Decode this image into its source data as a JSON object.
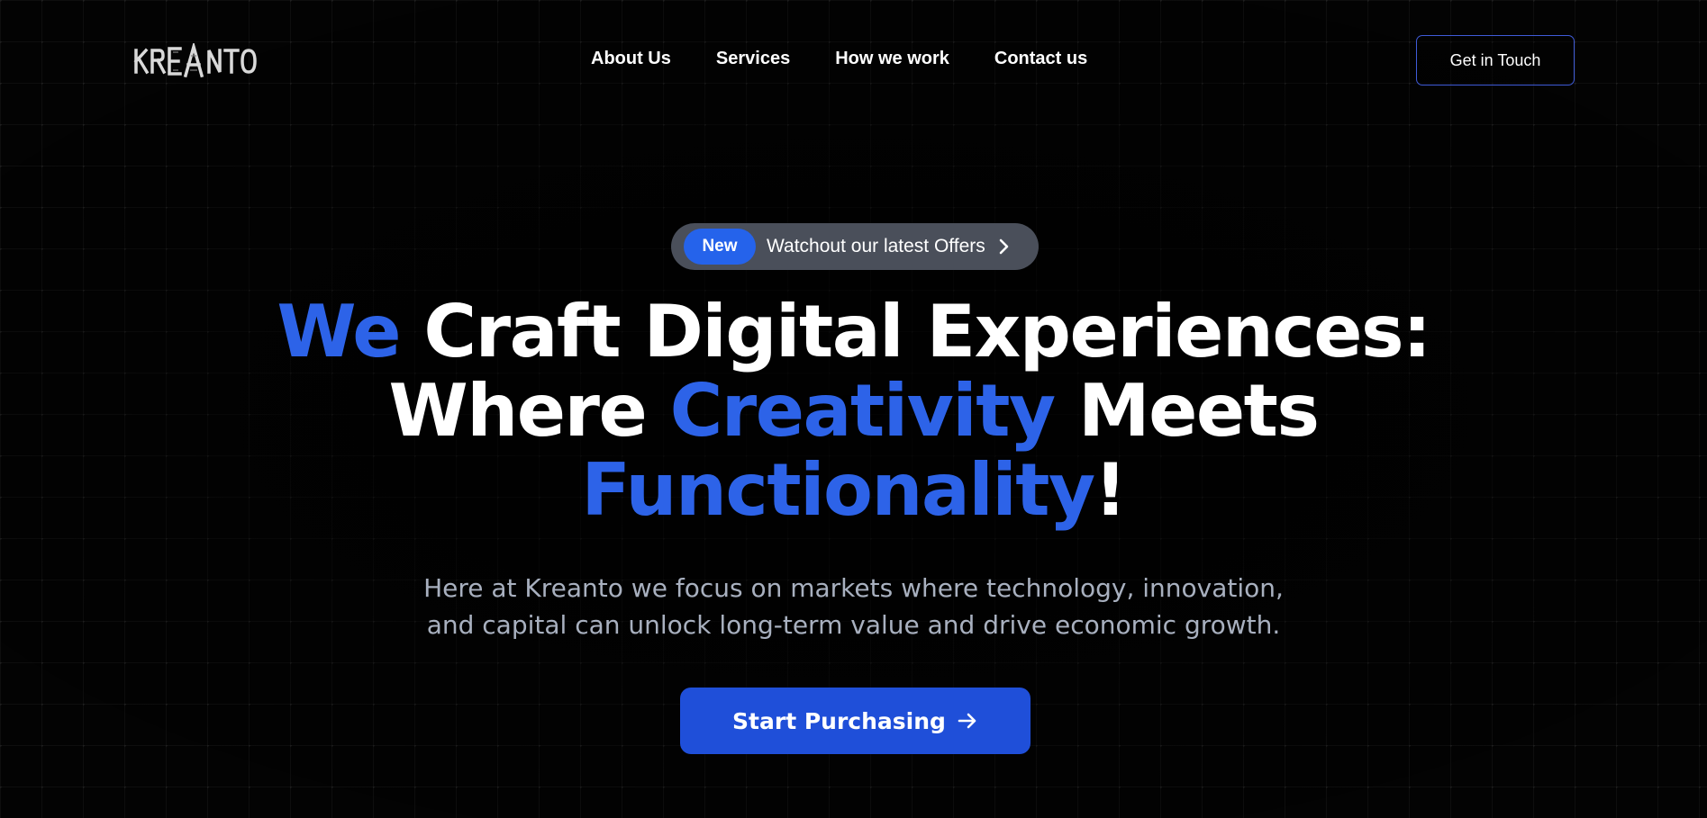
{
  "brand": {
    "logo_text": "KREANTO"
  },
  "nav": {
    "items": [
      {
        "label": "About Us"
      },
      {
        "label": "Services"
      },
      {
        "label": "How we work"
      },
      {
        "label": "Contact us"
      }
    ],
    "cta_label": "Get in Touch"
  },
  "announcement": {
    "badge": "New",
    "text": "Watchout our latest Offers",
    "icon": "chevron-right-icon"
  },
  "hero": {
    "headline_line1_accent": "We",
    "headline_line1_rest": "Craft Digital Experiences:",
    "headline_line2_start": "Where",
    "headline_line2_accent": "Creativity",
    "headline_line2_end": "Meets",
    "headline_line3_accent": "Functionality",
    "headline_line3_end": "!",
    "subtitle_line1": "Here at Kreanto we focus on markets where technology, innovation,",
    "subtitle_line2": "and capital can unlock long-term value and drive economic growth.",
    "cta_label": "Start Purchasing",
    "cta_icon": "arrow-right-icon"
  },
  "colors": {
    "background": "#030303",
    "accent": "#2d63e8",
    "button": "#1f4fd9",
    "pill": "#4a4f5a",
    "subtitle": "#a8b0bf"
  }
}
